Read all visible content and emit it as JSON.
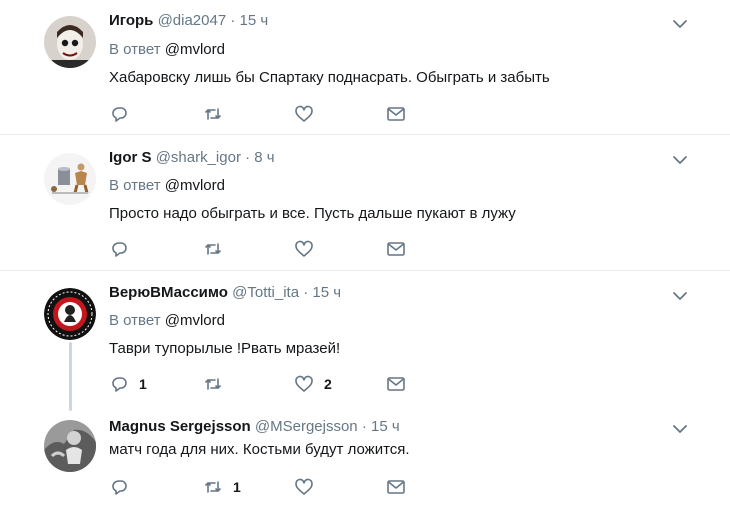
{
  "tweets": [
    {
      "name": "Игорь",
      "handle": "@dia2047",
      "sep": "·",
      "time": "15 ч",
      "reply_prefix": "В ответ",
      "reply_to": "@mvlord",
      "text": "Хабаровску лишь бы Спартаку поднасрать. Обыграть и забыть",
      "reply_count": "",
      "retweet_count": "",
      "like_count": ""
    },
    {
      "name": "Igor S",
      "handle": "@shark_igor",
      "sep": "·",
      "time": "8 ч",
      "reply_prefix": "В ответ",
      "reply_to": "@mvlord",
      "text": "Просто надо обыграть и все. Пусть дальше пукают в лужу",
      "reply_count": "",
      "retweet_count": "",
      "like_count": ""
    },
    {
      "name": "ВерюВМассимо",
      "handle": "@Totti_ita",
      "sep": "·",
      "time": "15 ч",
      "reply_prefix": "В ответ",
      "reply_to": "@mvlord",
      "text": "Таври тупорылые !Рвать мразей!",
      "reply_count": "1",
      "retweet_count": "",
      "like_count": "2"
    },
    {
      "name": "Magnus Sergejsson",
      "handle": "@MSergejsson",
      "sep": "·",
      "time": "15 ч",
      "text": "матч года для них. Костьми будут ложится.",
      "reply_count": "",
      "retweet_count": "1",
      "like_count": ""
    }
  ],
  "colors": {
    "icon": "#657786",
    "divider": "#e6ecf0",
    "thread_line": "#ccd6dd"
  },
  "icons": [
    "reply-icon",
    "retweet-icon",
    "like-icon",
    "direct-message-icon",
    "chevron-down-icon"
  ]
}
